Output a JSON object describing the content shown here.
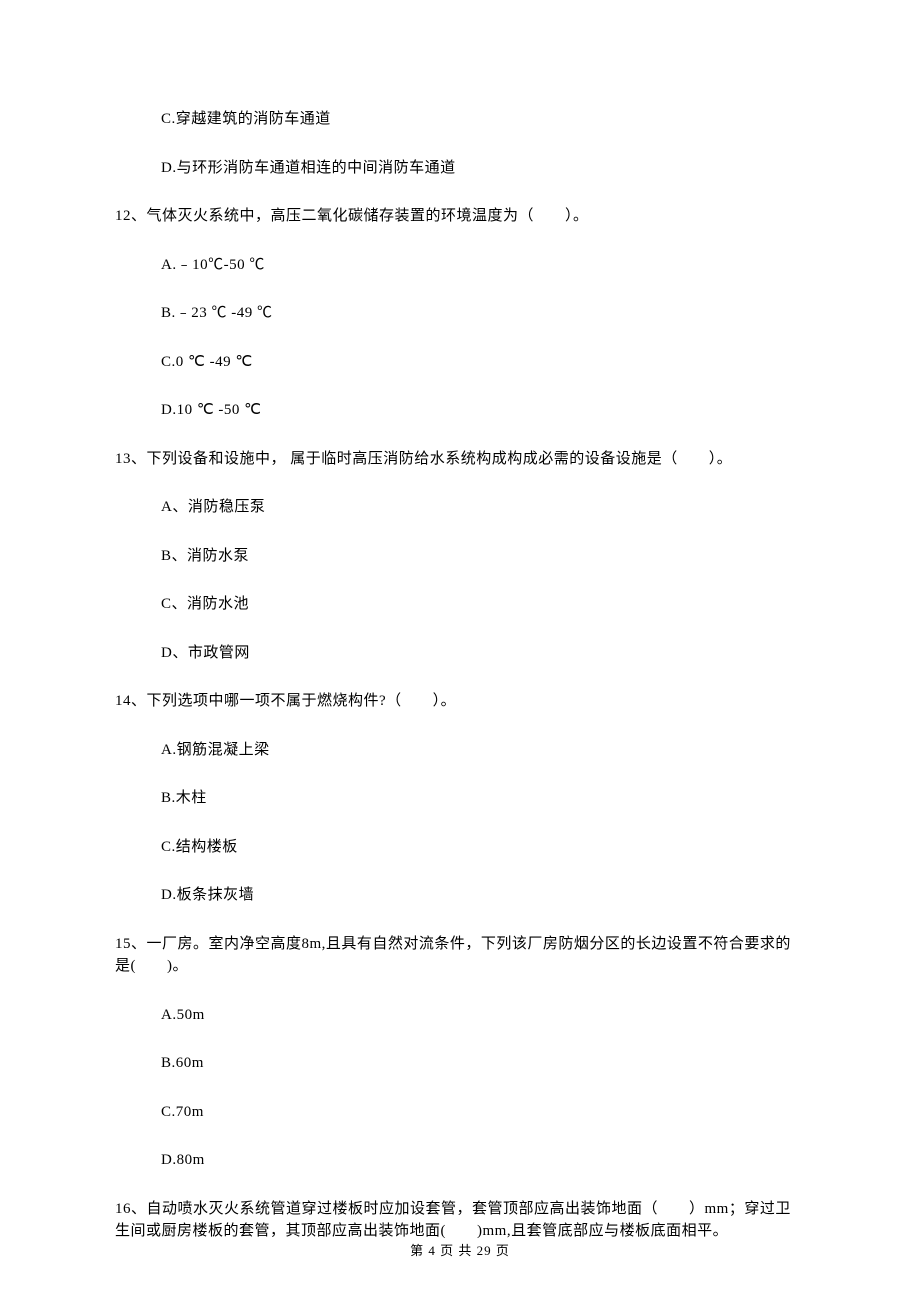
{
  "q11": {
    "optC": "C.穿越建筑的消防车通道",
    "optD": "D.与环形消防车通道相连的中间消防车通道"
  },
  "q12": {
    "stem": "12、气体灭火系统中，高压二氧化碳储存装置的环境温度为（　　）。",
    "optA": "A.﹣10℃-50 ℃",
    "optB": "B.﹣23 ℃ -49 ℃",
    "optC": "C.0 ℃ -49 ℃",
    "optD": "D.10 ℃ -50 ℃"
  },
  "q13": {
    "stem": "13、下列设备和设施中， 属于临时高压消防给水系统构成构成必需的设备设施是（　　）。",
    "optA": "A、消防稳压泵",
    "optB": "B、消防水泵",
    "optC": "C、消防水池",
    "optD": "D、市政管网"
  },
  "q14": {
    "stem": "14、下列选项中哪一项不属于燃烧构件?（　　）。",
    "optA": "A.钢筋混凝上梁",
    "optB": "B.木柱",
    "optC": "C.结构楼板",
    "optD": "D.板条抹灰墙"
  },
  "q15": {
    "stem": "15、一厂房。室内净空高度8m,且具有自然对流条件，下列该厂房防烟分区的长边设置不符合要求的是(　　)。",
    "optA": "A.50m",
    "optB": "B.60m",
    "optC": "C.70m",
    "optD": "D.80m"
  },
  "q16": {
    "stem": "16、自动喷水灭火系统管道穿过楼板时应加设套管，套管顶部应高出装饰地面（　　）mm；穿过卫生间或厨房楼板的套管，其顶部应高出装饰地面(　　)mm,且套管底部应与楼板底面相平。"
  },
  "footer": "第 4 页 共 29 页"
}
